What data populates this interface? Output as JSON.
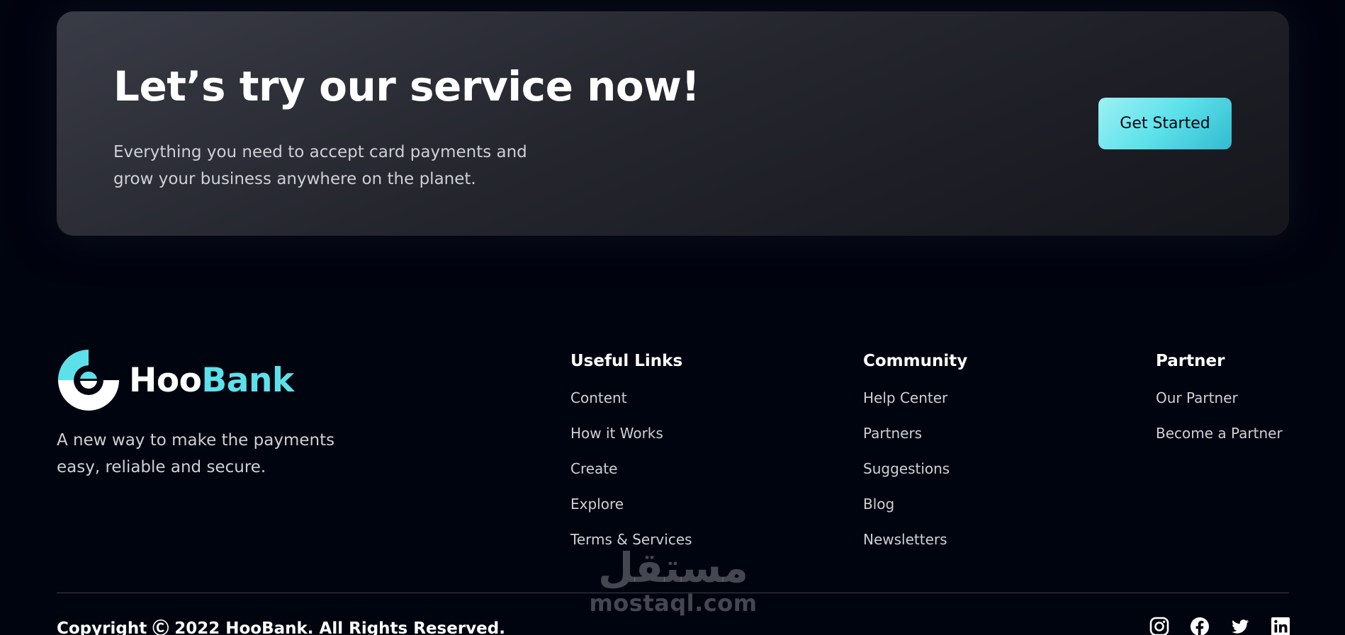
{
  "cta": {
    "title": "Let’s try our service now!",
    "text": "Everything you need to accept card payments and grow your business anywhere on the planet.",
    "button_label": "Get Started"
  },
  "brand": {
    "name_part1": "Hoo",
    "name_part2": "Bank",
    "tagline": "A new way to make the payments easy, reliable and secure."
  },
  "footer": {
    "columns": [
      {
        "title": "Useful Links",
        "links": [
          "Content",
          "How it Works",
          "Create",
          "Explore",
          "Terms & Services"
        ]
      },
      {
        "title": "Community",
        "links": [
          "Help Center",
          "Partners",
          "Suggestions",
          "Blog",
          "Newsletters"
        ]
      },
      {
        "title": "Partner",
        "links": [
          "Our Partner",
          "Become a Partner"
        ]
      }
    ],
    "copyright": "Copyright Ⓒ 2022 HooBank. All Rights Reserved.",
    "socials": [
      "instagram-icon",
      "facebook-icon",
      "twitter-icon",
      "linkedin-icon"
    ]
  },
  "watermark": {
    "arabic": "مستقل",
    "latin": "mostaql.com"
  },
  "colors": {
    "background": "#00040f",
    "accent": "#5ce1ea",
    "text_muted": "#cfd0d6"
  }
}
